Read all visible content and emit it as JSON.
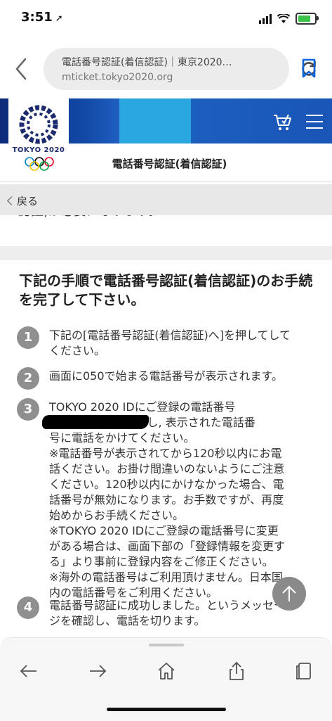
{
  "status_bar": {
    "time": "3:51",
    "battery_charging": true
  },
  "browser": {
    "page_title": "電話番号認証(着信認証)｜東京2020…",
    "url": "mticket.tokyo2020.org"
  },
  "site": {
    "logo_text": "TOKYO 2020",
    "page_heading": "電話番号認証(着信認証)",
    "back_label": "戻る",
    "cut_off_text": "認証)が必要になります。"
  },
  "content": {
    "heading_line1": "下記の手順で電話番号認証(着信認証)のお手続",
    "heading_line2": "を完了して下さい。",
    "steps": [
      {
        "num": "1",
        "lines": [
          "下記の[電話番号認証(着信認証)へ]を押してして",
          "ください。"
        ]
      },
      {
        "num": "2",
        "lines": [
          "画面に050で始まる電話番号が表示されます。"
        ]
      },
      {
        "num": "3",
        "lines": [
          "TOKYO 2020 IDにご登録の電話番号",
          "                  を使用し, 表示された電話番",
          "号に電話をかけてください。",
          "※電話番号が表示されてから120秒以内にお電",
          "話ください。お掛け間違いのないようにご注意",
          "ください。120秒以内にかけなかった場合、電",
          "話番号が無効になります。お手数ですが、再度",
          "始めからお手続ください。",
          "※TOKYO 2020 IDにご登録の電話番号に変更",
          "がある場合は、画面下部の「登録情報を変更す",
          "る」より事前に登録内容をご修正ください。",
          "※海外の電話番号はご利用頂けません。日本国",
          "内の電話番号をご利用ください。"
        ]
      },
      {
        "num": "4",
        "lines": [
          "電話番号認証に成功しました。というメッセー",
          "ジを確認し、電話を切ります。"
        ]
      }
    ]
  },
  "colors": {
    "brand_blue": "#1248a6",
    "accent_cyan": "#2aa7de",
    "step_badge": "#8f8f8f",
    "link_blue": "#0a64d8"
  }
}
